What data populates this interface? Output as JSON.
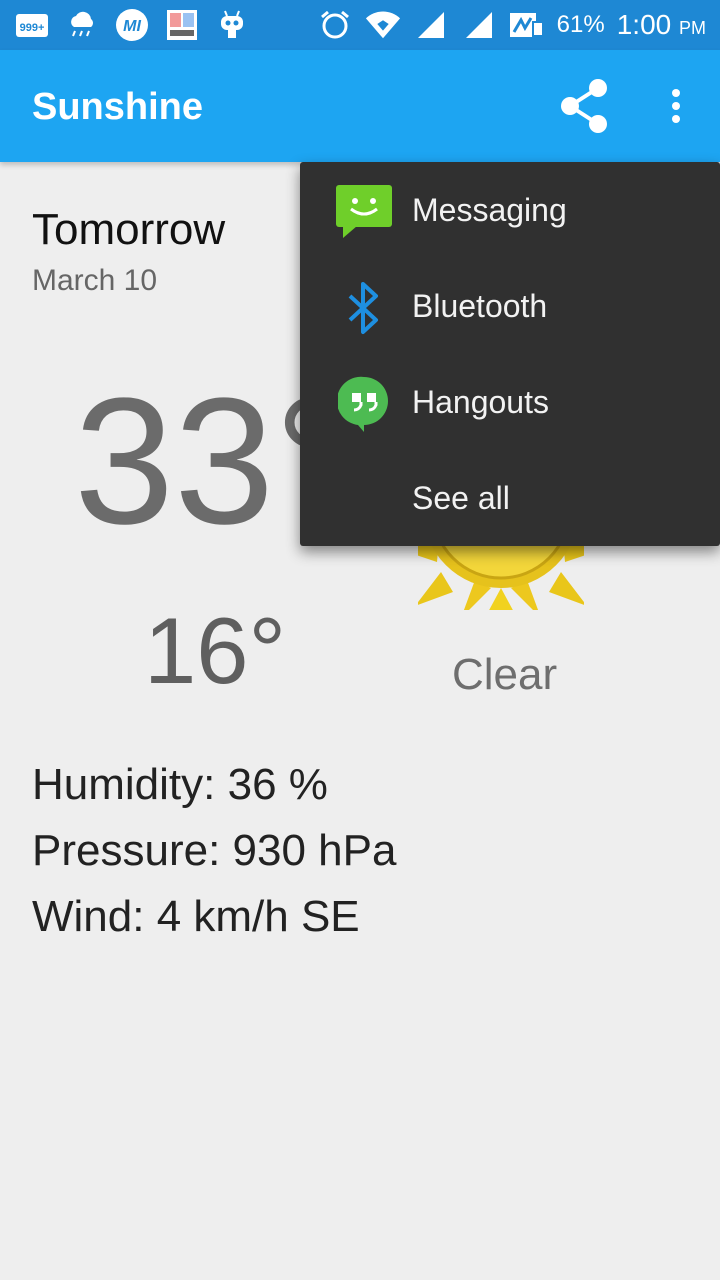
{
  "status_bar": {
    "notification_count": "999+",
    "battery": "61%",
    "time": "1:00",
    "ampm": "PM",
    "icons": [
      "notification-icon",
      "cloud-rain-icon",
      "mi-icon",
      "app-icon",
      "cyanogen-icon",
      "alarm-icon",
      "wifi-icon",
      "signal-icon",
      "signal-icon",
      "data-icon"
    ]
  },
  "appbar": {
    "title": "Sunshine",
    "share_icon": "share-icon",
    "more_icon": "more-vert-icon"
  },
  "forecast": {
    "day": "Tomorrow",
    "date": "March 10",
    "high": "33°",
    "low": "16°",
    "condition": "Clear",
    "humidity": "Humidity: 36 %",
    "pressure": "Pressure: 930 hPa",
    "wind": "Wind: 4 km/h SE",
    "icon": "sun-icon"
  },
  "share_menu": {
    "items": [
      {
        "label": "Messaging",
        "icon": "messaging-icon"
      },
      {
        "label": "Bluetooth",
        "icon": "bluetooth-icon"
      },
      {
        "label": "Hangouts",
        "icon": "hangouts-icon"
      },
      {
        "label": "See all",
        "icon": ""
      }
    ]
  },
  "colors": {
    "status_bar": "#1e88d4",
    "app_bar": "#1da5f2",
    "menu_bg": "#303030",
    "background": "#eeeeee"
  }
}
